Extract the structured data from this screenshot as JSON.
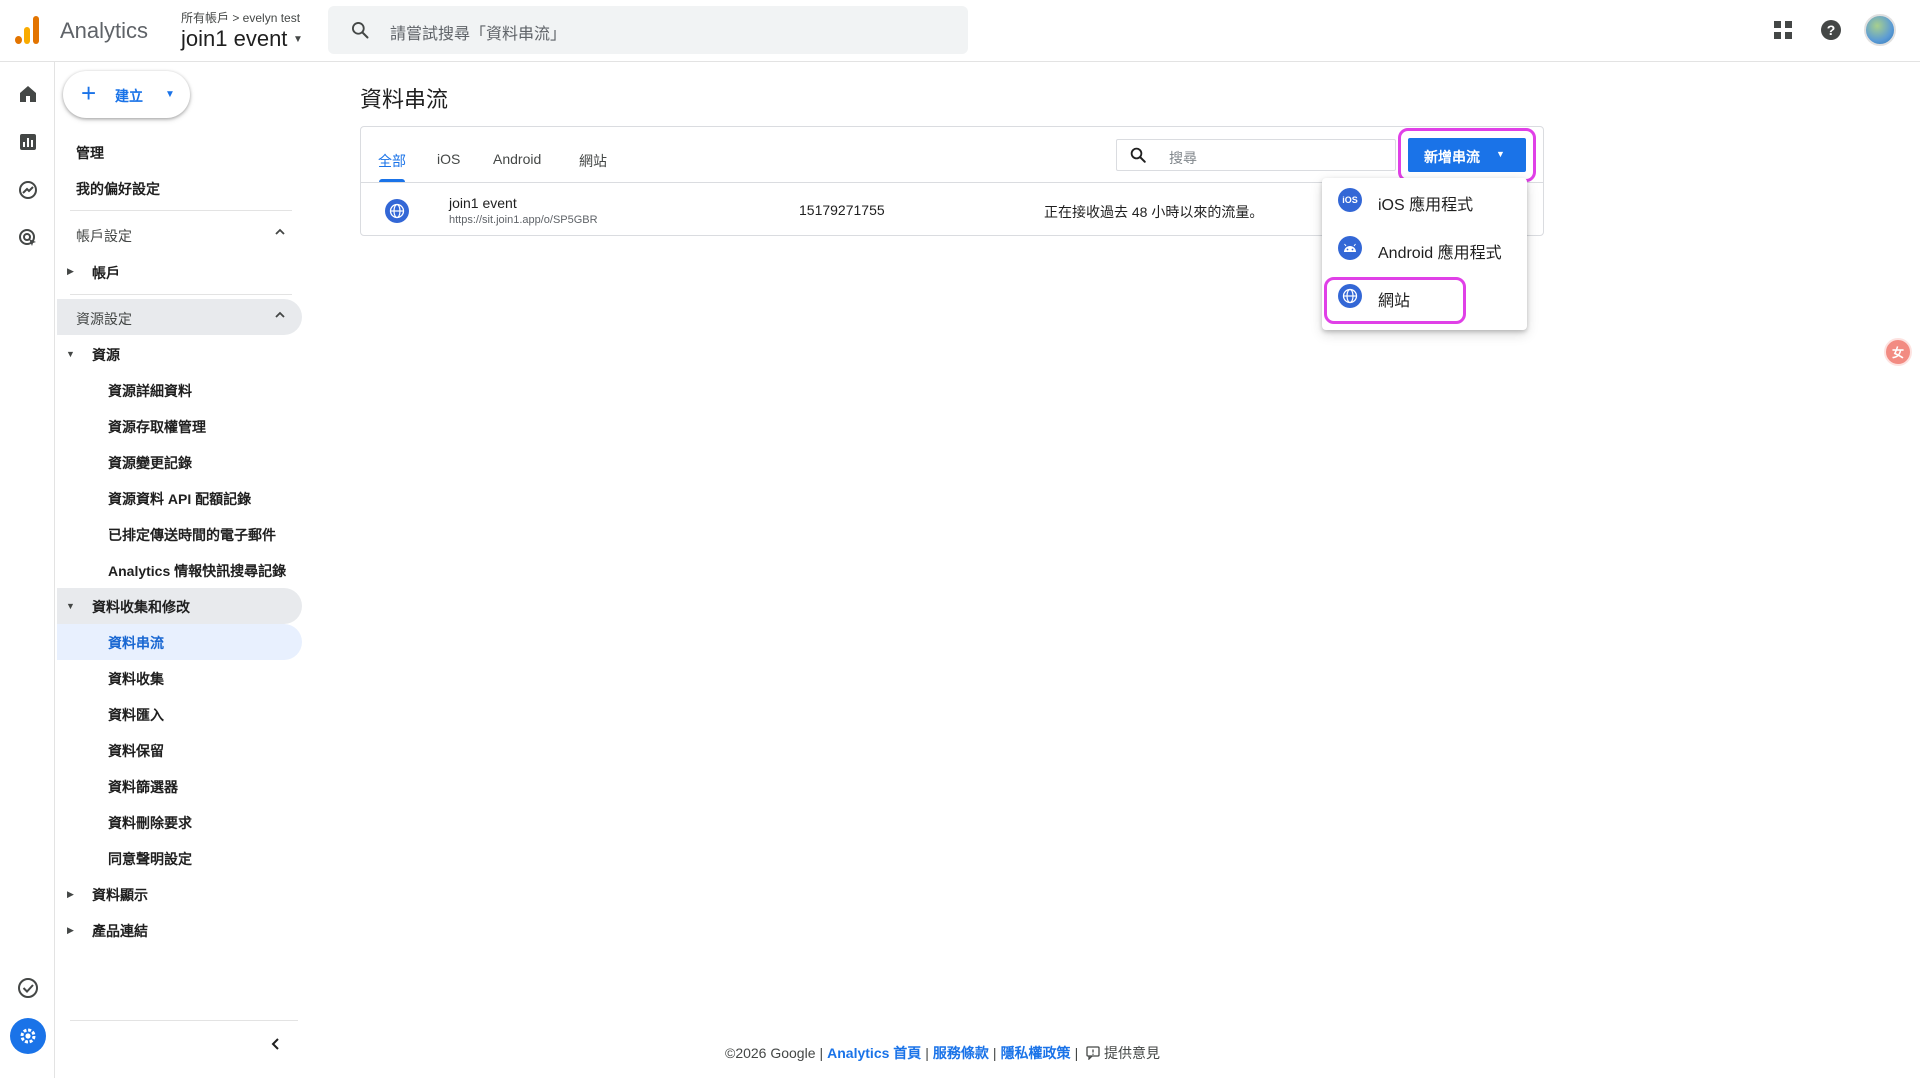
{
  "header": {
    "app_name": "Analytics",
    "account_crumb": "所有帳戶 > evelyn test",
    "property_name": "join1 event",
    "search_placeholder": "請嘗試搜尋「資料串流」"
  },
  "admin_nav": {
    "create_label": "建立",
    "admin_label": "管理",
    "preferences_label": "我的偏好設定",
    "account_settings_label": "帳戶設定",
    "account_label": "帳戶",
    "property_settings_label": "資源設定",
    "property_label": "資源",
    "property_items": [
      "資源詳細資料",
      "資源存取權管理",
      "資源變更記錄",
      "資源資料 API 配額記錄",
      "已排定傳送時間的電子郵件",
      "Analytics 情報快訊搜尋記錄"
    ],
    "data_collection_label": "資料收集和修改",
    "data_collection_items": [
      "資料串流",
      "資料收集",
      "資料匯入",
      "資料保留",
      "資料篩選器",
      "資料刪除要求",
      "同意聲明設定"
    ],
    "data_display_label": "資料顯示",
    "product_links_label": "產品連結"
  },
  "main": {
    "title": "資料串流",
    "tabs": [
      "全部",
      "iOS",
      "Android",
      "網站"
    ],
    "search_placeholder": "搜尋",
    "add_stream_label": "新增串流",
    "stream": {
      "name": "join1 event",
      "url": "https://sit.join1.app/o/SP5GBR",
      "id": "15179271755",
      "status": "正在接收過去 48 小時以來的流量。"
    },
    "menu_items": [
      {
        "icon_text": "iOS",
        "label": "iOS 應用程式"
      },
      {
        "icon_text": "",
        "label": "Android 應用程式"
      },
      {
        "icon_text": "",
        "label": "網站"
      }
    ]
  },
  "footer": {
    "copyright": "©2026 Google",
    "home_link": "Analytics 首頁",
    "terms_link": "服務條款",
    "privacy_link": "隱私權政策",
    "feedback_label": "提供意見"
  },
  "side_badge_text": "女",
  "colors": {
    "accent": "#1a73e8",
    "highlight_box": "#e040e7",
    "active_nav_bg": "#e8f0fe"
  }
}
